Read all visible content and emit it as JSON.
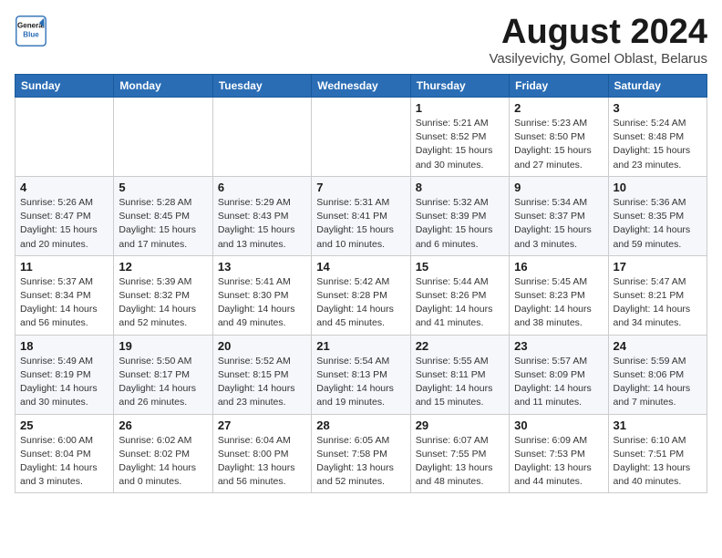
{
  "logo": {
    "line1": "General",
    "line2": "Blue"
  },
  "title": "August 2024",
  "location": "Vasilyevichy, Gomel Oblast, Belarus",
  "weekdays": [
    "Sunday",
    "Monday",
    "Tuesday",
    "Wednesday",
    "Thursday",
    "Friday",
    "Saturday"
  ],
  "weeks": [
    [
      {
        "day": "",
        "info": ""
      },
      {
        "day": "",
        "info": ""
      },
      {
        "day": "",
        "info": ""
      },
      {
        "day": "",
        "info": ""
      },
      {
        "day": "1",
        "info": "Sunrise: 5:21 AM\nSunset: 8:52 PM\nDaylight: 15 hours\nand 30 minutes."
      },
      {
        "day": "2",
        "info": "Sunrise: 5:23 AM\nSunset: 8:50 PM\nDaylight: 15 hours\nand 27 minutes."
      },
      {
        "day": "3",
        "info": "Sunrise: 5:24 AM\nSunset: 8:48 PM\nDaylight: 15 hours\nand 23 minutes."
      }
    ],
    [
      {
        "day": "4",
        "info": "Sunrise: 5:26 AM\nSunset: 8:47 PM\nDaylight: 15 hours\nand 20 minutes."
      },
      {
        "day": "5",
        "info": "Sunrise: 5:28 AM\nSunset: 8:45 PM\nDaylight: 15 hours\nand 17 minutes."
      },
      {
        "day": "6",
        "info": "Sunrise: 5:29 AM\nSunset: 8:43 PM\nDaylight: 15 hours\nand 13 minutes."
      },
      {
        "day": "7",
        "info": "Sunrise: 5:31 AM\nSunset: 8:41 PM\nDaylight: 15 hours\nand 10 minutes."
      },
      {
        "day": "8",
        "info": "Sunrise: 5:32 AM\nSunset: 8:39 PM\nDaylight: 15 hours\nand 6 minutes."
      },
      {
        "day": "9",
        "info": "Sunrise: 5:34 AM\nSunset: 8:37 PM\nDaylight: 15 hours\nand 3 minutes."
      },
      {
        "day": "10",
        "info": "Sunrise: 5:36 AM\nSunset: 8:35 PM\nDaylight: 14 hours\nand 59 minutes."
      }
    ],
    [
      {
        "day": "11",
        "info": "Sunrise: 5:37 AM\nSunset: 8:34 PM\nDaylight: 14 hours\nand 56 minutes."
      },
      {
        "day": "12",
        "info": "Sunrise: 5:39 AM\nSunset: 8:32 PM\nDaylight: 14 hours\nand 52 minutes."
      },
      {
        "day": "13",
        "info": "Sunrise: 5:41 AM\nSunset: 8:30 PM\nDaylight: 14 hours\nand 49 minutes."
      },
      {
        "day": "14",
        "info": "Sunrise: 5:42 AM\nSunset: 8:28 PM\nDaylight: 14 hours\nand 45 minutes."
      },
      {
        "day": "15",
        "info": "Sunrise: 5:44 AM\nSunset: 8:26 PM\nDaylight: 14 hours\nand 41 minutes."
      },
      {
        "day": "16",
        "info": "Sunrise: 5:45 AM\nSunset: 8:23 PM\nDaylight: 14 hours\nand 38 minutes."
      },
      {
        "day": "17",
        "info": "Sunrise: 5:47 AM\nSunset: 8:21 PM\nDaylight: 14 hours\nand 34 minutes."
      }
    ],
    [
      {
        "day": "18",
        "info": "Sunrise: 5:49 AM\nSunset: 8:19 PM\nDaylight: 14 hours\nand 30 minutes."
      },
      {
        "day": "19",
        "info": "Sunrise: 5:50 AM\nSunset: 8:17 PM\nDaylight: 14 hours\nand 26 minutes."
      },
      {
        "day": "20",
        "info": "Sunrise: 5:52 AM\nSunset: 8:15 PM\nDaylight: 14 hours\nand 23 minutes."
      },
      {
        "day": "21",
        "info": "Sunrise: 5:54 AM\nSunset: 8:13 PM\nDaylight: 14 hours\nand 19 minutes."
      },
      {
        "day": "22",
        "info": "Sunrise: 5:55 AM\nSunset: 8:11 PM\nDaylight: 14 hours\nand 15 minutes."
      },
      {
        "day": "23",
        "info": "Sunrise: 5:57 AM\nSunset: 8:09 PM\nDaylight: 14 hours\nand 11 minutes."
      },
      {
        "day": "24",
        "info": "Sunrise: 5:59 AM\nSunset: 8:06 PM\nDaylight: 14 hours\nand 7 minutes."
      }
    ],
    [
      {
        "day": "25",
        "info": "Sunrise: 6:00 AM\nSunset: 8:04 PM\nDaylight: 14 hours\nand 3 minutes."
      },
      {
        "day": "26",
        "info": "Sunrise: 6:02 AM\nSunset: 8:02 PM\nDaylight: 14 hours\nand 0 minutes."
      },
      {
        "day": "27",
        "info": "Sunrise: 6:04 AM\nSunset: 8:00 PM\nDaylight: 13 hours\nand 56 minutes."
      },
      {
        "day": "28",
        "info": "Sunrise: 6:05 AM\nSunset: 7:58 PM\nDaylight: 13 hours\nand 52 minutes."
      },
      {
        "day": "29",
        "info": "Sunrise: 6:07 AM\nSunset: 7:55 PM\nDaylight: 13 hours\nand 48 minutes."
      },
      {
        "day": "30",
        "info": "Sunrise: 6:09 AM\nSunset: 7:53 PM\nDaylight: 13 hours\nand 44 minutes."
      },
      {
        "day": "31",
        "info": "Sunrise: 6:10 AM\nSunset: 7:51 PM\nDaylight: 13 hours\nand 40 minutes."
      }
    ]
  ]
}
